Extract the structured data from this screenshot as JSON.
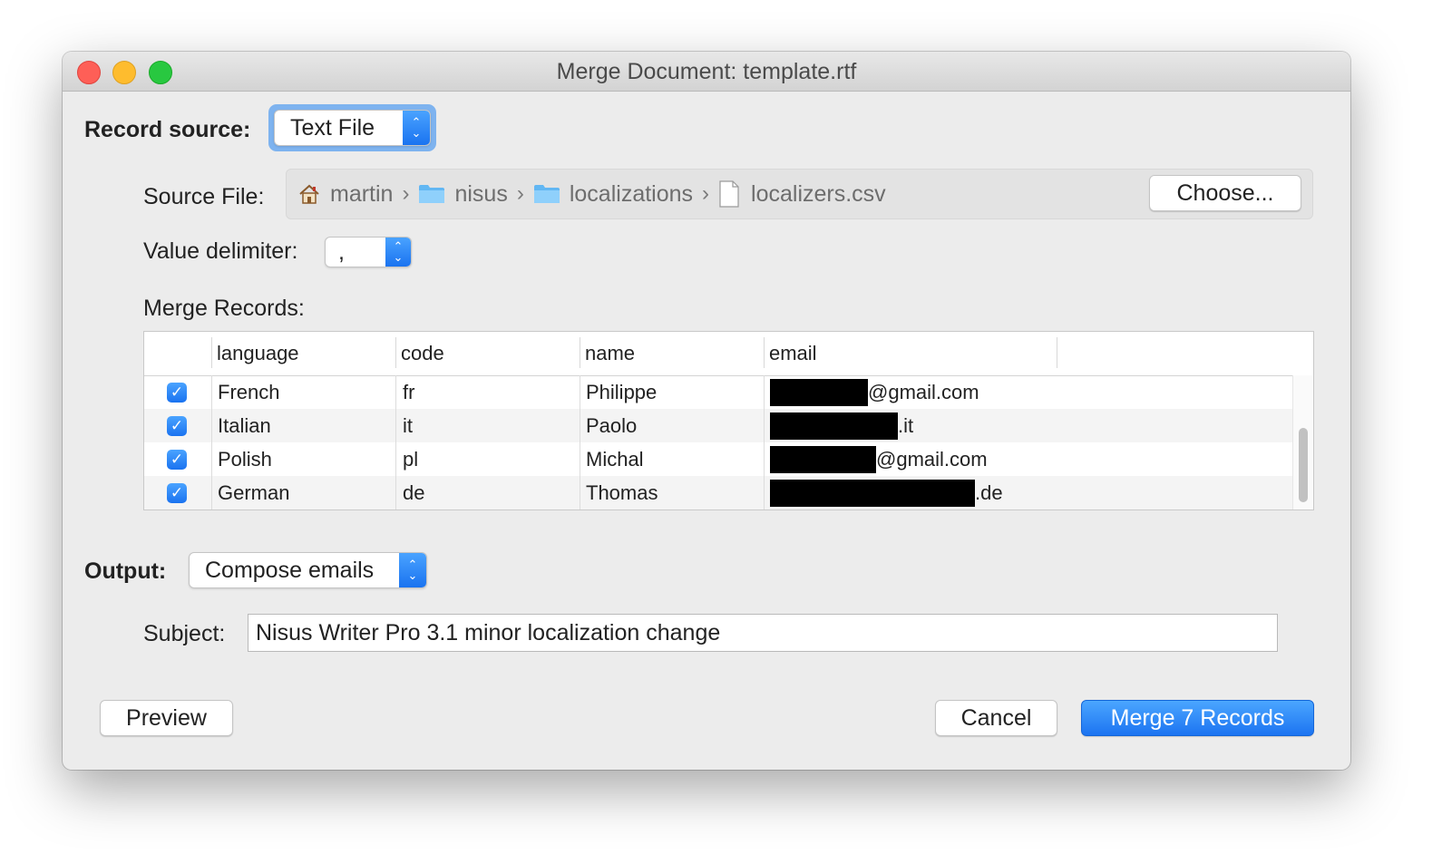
{
  "window": {
    "title": "Merge Document: template.rtf"
  },
  "record_source": {
    "label": "Record source:",
    "value": "Text File"
  },
  "source_file": {
    "label": "Source File:",
    "path": [
      {
        "name": "martin",
        "icon": "home-icon"
      },
      {
        "name": "nisus",
        "icon": "folder-icon"
      },
      {
        "name": "localizations",
        "icon": "folder-icon"
      },
      {
        "name": "localizers.csv",
        "icon": "file-icon"
      }
    ],
    "separator": "›",
    "choose_label": "Choose..."
  },
  "value_delimiter": {
    "label": "Value delimiter:",
    "value": ","
  },
  "merge_records": {
    "label": "Merge Records:",
    "columns": [
      "language",
      "code",
      "name",
      "email"
    ],
    "rows": [
      {
        "checked": true,
        "language": "French",
        "code": "fr",
        "name": "Philippe",
        "email_suffix": "@gmail.com"
      },
      {
        "checked": true,
        "language": "Italian",
        "code": "it",
        "name": "Paolo",
        "email_suffix": ".it"
      },
      {
        "checked": true,
        "language": "Polish",
        "code": "pl",
        "name": "Michal",
        "email_suffix": "@gmail.com"
      },
      {
        "checked": true,
        "language": "German",
        "code": "de",
        "name": "Thomas",
        "email_suffix": ".de"
      }
    ]
  },
  "output": {
    "label": "Output:",
    "value": "Compose emails"
  },
  "subject": {
    "label": "Subject:",
    "value": "Nisus Writer Pro 3.1 minor localization change"
  },
  "buttons": {
    "preview": "Preview",
    "cancel": "Cancel",
    "merge": "Merge 7 Records"
  },
  "glyphs": {
    "check": "✓",
    "up": "⌃",
    "down": "⌄"
  },
  "colors": {
    "accent": "#1a73f0",
    "close": "#fe5f57",
    "minimize": "#febc2e",
    "zoom": "#28c840"
  }
}
